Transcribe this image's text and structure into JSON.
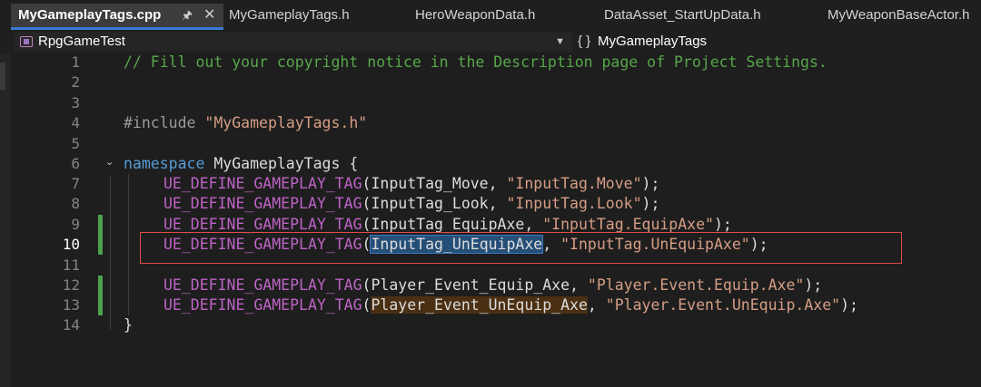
{
  "tabs": [
    {
      "label": "MyGameplayTags.cpp",
      "active": true
    },
    {
      "label": "MyGameplayTags.h"
    },
    {
      "label": "HeroWeaponData.h"
    },
    {
      "label": "DataAsset_StartUpData.h"
    },
    {
      "label": "MyWeaponBaseActor.h"
    }
  ],
  "tab_pin_icon": "pin-icon",
  "tab_close": "✕",
  "nav": {
    "project": "RpgGameTest",
    "scope_icon": "{ }",
    "scope": "MyGameplayTags"
  },
  "lines": {
    "n1": "1",
    "n2": "2",
    "n3": "3",
    "n4": "4",
    "n5": "5",
    "n6": "6",
    "n7": "7",
    "n8": "8",
    "n9": "9",
    "n10": "10",
    "n11": "11",
    "n12": "12",
    "n13": "13",
    "n14": "14",
    "l1": "// Fill out your copyright notice in the Description page of Project Settings.",
    "l4_directive": "#include",
    "l4_string": "\"MyGameplayTags.h\"",
    "l6_keyword": "namespace",
    "l6_rest": " MyGameplayTags {",
    "macro": "UE_DEFINE_GAMEPLAY_TAG",
    "l7_arg": "(InputTag_Move, ",
    "l7_str": "\"InputTag.Move\"",
    "l8_arg": "(InputTag_Look, ",
    "l8_str": "\"InputTag.Look\"",
    "l9_arg": "(InputTag_EquipAxe, ",
    "l9_str": "\"InputTag.EquipAxe\"",
    "l10_open": "(",
    "l10_sel": "InputTag_UnEquipAxe",
    "l10_comma": ", ",
    "l10_str": "\"InputTag.UnEquipAxe\"",
    "l12_arg": "(Player_Event_Equip_Axe, ",
    "l12_str": "\"Player.Event.Equip.Axe\"",
    "l13_open": "(",
    "l13_hl": "Player_Event_UnEquip_Axe",
    "l13_comma": ", ",
    "l13_str": "\"Player.Event.UnEquip.Axe\"",
    "close_paren": ");",
    "l14": "}",
    "fold_icon": "⌄"
  },
  "colors": {
    "comment": "#57a64a",
    "keyword": "#569cd6",
    "string": "#d69d85",
    "macro": "#bd63c5",
    "annotation_box": "#e04a4a"
  }
}
